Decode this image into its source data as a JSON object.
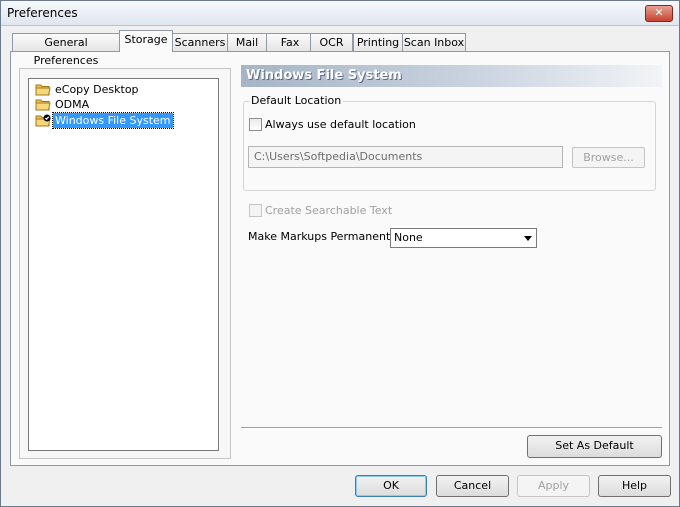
{
  "window": {
    "title": "Preferences",
    "close_glyph": "✕"
  },
  "tabs": [
    {
      "label": "General Preferences"
    },
    {
      "label": "Storage"
    },
    {
      "label": "Scanners"
    },
    {
      "label": "Mail"
    },
    {
      "label": "Fax"
    },
    {
      "label": "OCR"
    },
    {
      "label": "Printing"
    },
    {
      "label": "Scan Inbox"
    }
  ],
  "active_tab": "Storage",
  "tree": {
    "items": [
      {
        "label": "eCopy Desktop",
        "icon": "folder-icon"
      },
      {
        "label": "ODMA",
        "icon": "folder-icon"
      },
      {
        "label": "Windows File System",
        "icon": "folder-check-icon",
        "selected": true
      }
    ]
  },
  "panel": {
    "header": "Windows File System",
    "default_location": {
      "group_label": "Default Location",
      "always_use_label": "Always use default location",
      "always_use_checked": false,
      "path_value": "C:\\Users\\Softpedia\\Documents",
      "browse_label": "Browse..."
    },
    "create_searchable_label": "Create Searchable Text",
    "create_searchable_checked": false,
    "markups_label": "Make Markups Permanent:",
    "markups_value": "None",
    "set_default_label": "Set As Default"
  },
  "footer": {
    "ok_label": "OK",
    "cancel_label": "Cancel",
    "apply_label": "Apply",
    "help_label": "Help"
  },
  "colors": {
    "selection": "#3399ff",
    "header_start": "#a6b4c6",
    "folder": "#f2c14e",
    "close": "#c7432f"
  }
}
